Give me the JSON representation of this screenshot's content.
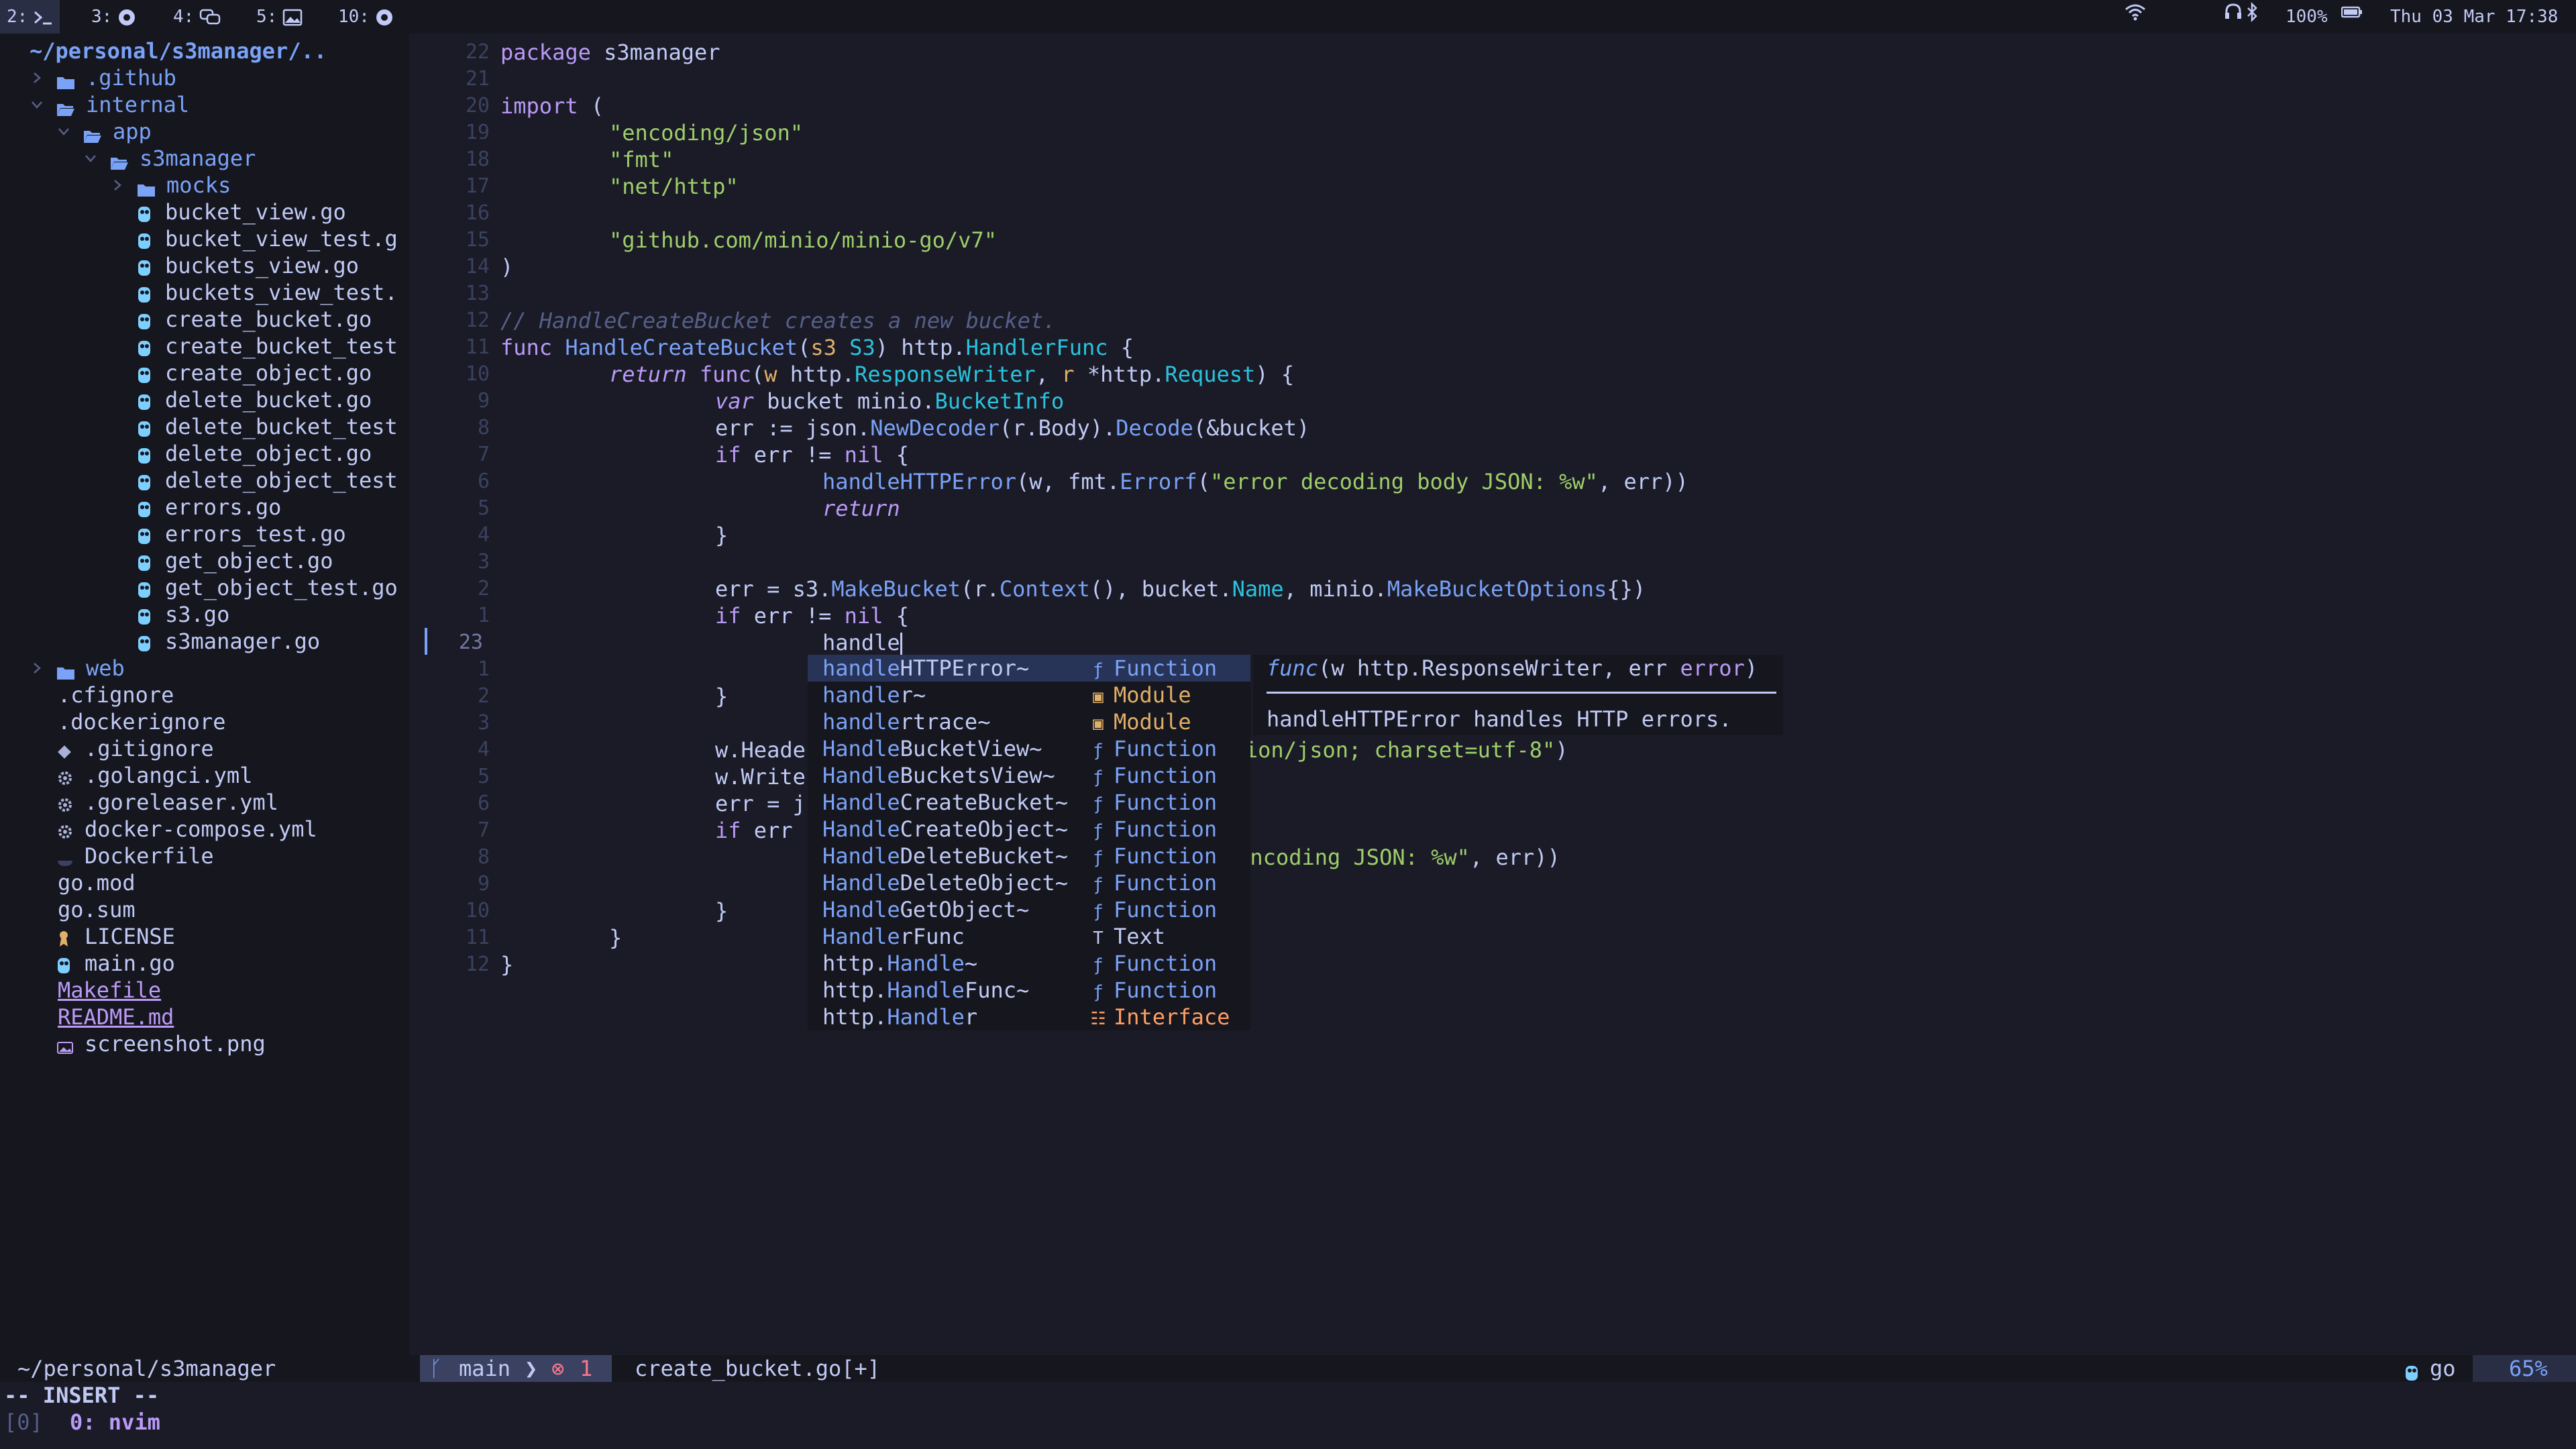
{
  "topbar": {
    "workspaces": [
      {
        "label": "2:",
        "icon": "terminal-icon",
        "active": true
      },
      {
        "label": "3:",
        "icon": "browser-icon",
        "active": false
      },
      {
        "label": "4:",
        "icon": "chat-icon",
        "active": false
      },
      {
        "label": "5:",
        "icon": "image-icon",
        "active": false
      },
      {
        "label": "10:",
        "icon": "browser-icon",
        "active": false
      }
    ],
    "battery": "100%",
    "datetime": "Thu 03 Mar 17:38"
  },
  "tree": {
    "root": "~/personal/s3manager/..",
    "items": [
      {
        "name": ".github",
        "type": "dir",
        "expanded": false,
        "depth": 0
      },
      {
        "name": "internal",
        "type": "dir",
        "expanded": true,
        "depth": 0
      },
      {
        "name": "app",
        "type": "dir",
        "expanded": true,
        "depth": 1
      },
      {
        "name": "s3manager",
        "type": "dir",
        "expanded": true,
        "depth": 2
      },
      {
        "name": "mocks",
        "type": "dir",
        "expanded": false,
        "depth": 3
      },
      {
        "name": "bucket_view.go",
        "type": "go",
        "depth": 4
      },
      {
        "name": "bucket_view_test.g",
        "type": "go",
        "depth": 4
      },
      {
        "name": "buckets_view.go",
        "type": "go",
        "depth": 4
      },
      {
        "name": "buckets_view_test.",
        "type": "go",
        "depth": 4
      },
      {
        "name": "create_bucket.go",
        "type": "go",
        "depth": 4
      },
      {
        "name": "create_bucket_test",
        "type": "go",
        "depth": 4
      },
      {
        "name": "create_object.go",
        "type": "go",
        "depth": 4
      },
      {
        "name": "delete_bucket.go",
        "type": "go",
        "depth": 4
      },
      {
        "name": "delete_bucket_test",
        "type": "go",
        "depth": 4
      },
      {
        "name": "delete_object.go",
        "type": "go",
        "depth": 4
      },
      {
        "name": "delete_object_test",
        "type": "go",
        "depth": 4
      },
      {
        "name": "errors.go",
        "type": "go",
        "depth": 4
      },
      {
        "name": "errors_test.go",
        "type": "go",
        "depth": 4
      },
      {
        "name": "get_object.go",
        "type": "go",
        "depth": 4
      },
      {
        "name": "get_object_test.go",
        "type": "go",
        "depth": 4
      },
      {
        "name": "s3.go",
        "type": "go",
        "depth": 4
      },
      {
        "name": "s3manager.go",
        "type": "go",
        "depth": 4
      },
      {
        "name": "web",
        "type": "dir",
        "expanded": false,
        "depth": 0
      },
      {
        "name": ".cfignore",
        "type": "plain",
        "depth": 1
      },
      {
        "name": ".dockerignore",
        "type": "plain",
        "depth": 1
      },
      {
        "name": ".gitignore",
        "type": "git",
        "depth": 1
      },
      {
        "name": ".golangci.yml",
        "type": "gear",
        "depth": 1
      },
      {
        "name": ".goreleaser.yml",
        "type": "gear",
        "depth": 1
      },
      {
        "name": "docker-compose.yml",
        "type": "gear",
        "depth": 1
      },
      {
        "name": "Dockerfile",
        "type": "docker",
        "depth": 1
      },
      {
        "name": "go.mod",
        "type": "plain",
        "depth": 1
      },
      {
        "name": "go.sum",
        "type": "plain",
        "depth": 1
      },
      {
        "name": "LICENSE",
        "type": "license",
        "depth": 1
      },
      {
        "name": "main.go",
        "type": "go",
        "depth": 1
      },
      {
        "name": "Makefile",
        "type": "link",
        "depth": 1
      },
      {
        "name": "README.md",
        "type": "link",
        "depth": 1
      },
      {
        "name": "screenshot.png",
        "type": "image",
        "depth": 1
      }
    ]
  },
  "editor": {
    "lines": [
      {
        "n": "22",
        "indent": 0,
        "segs": [
          [
            "kw",
            "package"
          ],
          [
            "pl",
            " s3manager"
          ]
        ]
      },
      {
        "n": "21",
        "indent": 0,
        "segs": []
      },
      {
        "n": "20",
        "indent": 0,
        "segs": [
          [
            "kw",
            "import"
          ],
          [
            "pl",
            " ("
          ]
        ]
      },
      {
        "n": "19",
        "indent": 1,
        "segs": [
          [
            "str",
            "\"encoding/json\""
          ]
        ]
      },
      {
        "n": "18",
        "indent": 1,
        "segs": [
          [
            "str",
            "\"fmt\""
          ]
        ]
      },
      {
        "n": "17",
        "indent": 1,
        "segs": [
          [
            "str",
            "\"net/http\""
          ]
        ]
      },
      {
        "n": "16",
        "indent": 0,
        "segs": []
      },
      {
        "n": "15",
        "indent": 1,
        "segs": [
          [
            "str",
            "\"github.com/minio/minio-go/v7\""
          ]
        ]
      },
      {
        "n": "14",
        "indent": 0,
        "segs": [
          [
            "pl",
            ")"
          ]
        ]
      },
      {
        "n": "13",
        "indent": 0,
        "segs": []
      },
      {
        "n": "12",
        "indent": 0,
        "segs": [
          [
            "cm",
            "// HandleCreateBucket creates a new bucket."
          ]
        ]
      },
      {
        "n": "11",
        "indent": 0,
        "segs": [
          [
            "kw",
            "func"
          ],
          [
            "pl",
            " "
          ],
          [
            "fn",
            "HandleCreateBucket"
          ],
          [
            "pl",
            "("
          ],
          [
            "pr",
            "s3"
          ],
          [
            "pl",
            " "
          ],
          [
            "ty",
            "S3"
          ],
          [
            "pl",
            ") http."
          ],
          [
            "ty",
            "HandlerFunc"
          ],
          [
            "pl",
            " {"
          ]
        ]
      },
      {
        "n": "10",
        "indent": 1,
        "segs": [
          [
            "kwi",
            "return"
          ],
          [
            "pl",
            " "
          ],
          [
            "kw",
            "func"
          ],
          [
            "pl",
            "("
          ],
          [
            "pr",
            "w"
          ],
          [
            "pl",
            " http."
          ],
          [
            "ty",
            "ResponseWriter"
          ],
          [
            "pl",
            ", "
          ],
          [
            "pr",
            "r"
          ],
          [
            "pl",
            " *http."
          ],
          [
            "ty",
            "Request"
          ],
          [
            "pl",
            ") {"
          ]
        ]
      },
      {
        "n": "9",
        "indent": 2,
        "segs": [
          [
            "kwi",
            "var"
          ],
          [
            "pl",
            " bucket minio."
          ],
          [
            "ty",
            "BucketInfo"
          ]
        ]
      },
      {
        "n": "8",
        "indent": 2,
        "segs": [
          [
            "pl",
            "err := json."
          ],
          [
            "fn",
            "NewDecoder"
          ],
          [
            "pl",
            "(r.Body)."
          ],
          [
            "fn",
            "Decode"
          ],
          [
            "pl",
            "(&bucket)"
          ]
        ]
      },
      {
        "n": "7",
        "indent": 2,
        "segs": [
          [
            "kw",
            "if"
          ],
          [
            "pl",
            " err != "
          ],
          [
            "kw",
            "nil"
          ],
          [
            "pl",
            " {"
          ]
        ]
      },
      {
        "n": "6",
        "indent": 3,
        "segs": [
          [
            "fn",
            "handleHTTPError"
          ],
          [
            "pl",
            "(w, fmt."
          ],
          [
            "fn",
            "Errorf"
          ],
          [
            "pl",
            "("
          ],
          [
            "str",
            "\"error decoding body JSON: %w\""
          ],
          [
            "pl",
            ", err))"
          ]
        ]
      },
      {
        "n": "5",
        "indent": 3,
        "segs": [
          [
            "kwi",
            "return"
          ]
        ]
      },
      {
        "n": "4",
        "indent": 2,
        "segs": [
          [
            "pl",
            "}"
          ]
        ]
      },
      {
        "n": "3",
        "indent": 0,
        "segs": []
      },
      {
        "n": "2",
        "indent": 2,
        "segs": [
          [
            "pl",
            "err = s3."
          ],
          [
            "fn",
            "MakeBucket"
          ],
          [
            "pl",
            "(r."
          ],
          [
            "fn",
            "Context"
          ],
          [
            "pl",
            "(), bucket."
          ],
          [
            "ty",
            "Name"
          ],
          [
            "pl",
            ", minio."
          ],
          [
            "fn",
            "MakeBucketOptions"
          ],
          [
            "pl",
            "{})"
          ]
        ]
      },
      {
        "n": "1",
        "indent": 2,
        "segs": [
          [
            "kw",
            "if"
          ],
          [
            "pl",
            " err != "
          ],
          [
            "kw",
            "nil"
          ],
          [
            "pl",
            " {"
          ]
        ]
      },
      {
        "n": "23",
        "indent": 3,
        "segs": [
          [
            "pl",
            "handle"
          ]
        ],
        "current": true
      },
      {
        "n": "1",
        "indent": 0,
        "segs": []
      },
      {
        "n": "2",
        "indent": 2,
        "segs": [
          [
            "pl",
            "}"
          ]
        ]
      },
      {
        "n": "3",
        "indent": 0,
        "segs": []
      },
      {
        "n": "4",
        "indent": 2,
        "segs": [
          [
            "pl",
            "w.Heade"
          ],
          [
            "sp",
            "                                  "
          ],
          [
            "str",
            "ion/json; charset=utf-8\""
          ],
          [
            "pl",
            ")"
          ]
        ]
      },
      {
        "n": "5",
        "indent": 2,
        "segs": [
          [
            "pl",
            "w.Write"
          ]
        ]
      },
      {
        "n": "6",
        "indent": 2,
        "segs": [
          [
            "pl",
            "err = j"
          ]
        ]
      },
      {
        "n": "7",
        "indent": 2,
        "segs": [
          [
            "kw",
            "if"
          ],
          [
            "pl",
            " err"
          ]
        ]
      },
      {
        "n": "8",
        "indent": 0,
        "segs": [
          [
            "sp",
            "                                                    "
          ],
          [
            "str",
            "rror encoding JSON: %w\""
          ],
          [
            "pl",
            ", err))"
          ]
        ]
      },
      {
        "n": "9",
        "indent": 0,
        "segs": []
      },
      {
        "n": "10",
        "indent": 2,
        "segs": [
          [
            "pl",
            "}"
          ]
        ]
      },
      {
        "n": "11",
        "indent": 1,
        "segs": [
          [
            "pl",
            "}"
          ]
        ]
      },
      {
        "n": "12",
        "indent": 0,
        "segs": [
          [
            "pl",
            "}"
          ]
        ]
      }
    ]
  },
  "completion": {
    "items": [
      {
        "match": "handle",
        "rest": "HTTPError~",
        "kind": "Function",
        "icon": "ƒ",
        "selected": true
      },
      {
        "match": "handle",
        "rest": "r~",
        "kind": "Module",
        "icon": "▣"
      },
      {
        "match": "handle",
        "rest": "rtrace~",
        "kind": "Module",
        "icon": "▣"
      },
      {
        "match": "Handle",
        "rest": "BucketView~",
        "kind": "Function",
        "icon": "ƒ"
      },
      {
        "match": "Handle",
        "rest": "BucketsView~",
        "kind": "Function",
        "icon": "ƒ"
      },
      {
        "match": "Handle",
        "rest": "CreateBucket~",
        "kind": "Function",
        "icon": "ƒ"
      },
      {
        "match": "Handle",
        "rest": "CreateObject~",
        "kind": "Function",
        "icon": "ƒ"
      },
      {
        "match": "Handle",
        "rest": "DeleteBucket~",
        "kind": "Function",
        "icon": "ƒ"
      },
      {
        "match": "Handle",
        "rest": "DeleteObject~",
        "kind": "Function",
        "icon": "ƒ"
      },
      {
        "match": "Handle",
        "rest": "GetObject~",
        "kind": "Function",
        "icon": "ƒ"
      },
      {
        "match": "Handle",
        "rest": "rFunc",
        "kind": "Text",
        "icon": "T"
      },
      {
        "pre": "http.",
        "match": "Handle",
        "rest": "~",
        "kind": "Function",
        "icon": "ƒ"
      },
      {
        "pre": "http.",
        "match": "Handle",
        "rest": "Func~",
        "kind": "Function",
        "icon": "ƒ"
      },
      {
        "pre": "http.",
        "match": "Handle",
        "rest": "r",
        "kind": "Interface",
        "icon": "☷"
      }
    ],
    "kind_colors": {
      "Function": "#7aa2f7",
      "Module": "#e0af68",
      "Text": "#c0caf5",
      "Interface": "#ff9e64"
    }
  },
  "docs": {
    "sig_kw": "func",
    "sig_rest": "(w http.ResponseWriter, err ",
    "sig_type": "error",
    "sig_end": ")",
    "description": "handleHTTPError handles HTTP errors."
  },
  "statusline": {
    "cwd": "~/personal/s3manager",
    "branch": "main",
    "errors": "1",
    "file": "create_bucket.go[+]",
    "filetype": "go",
    "percent": "65%"
  },
  "mode": "-- INSERT --",
  "tmux": {
    "session": "[0]",
    "window": "0: nvim"
  }
}
